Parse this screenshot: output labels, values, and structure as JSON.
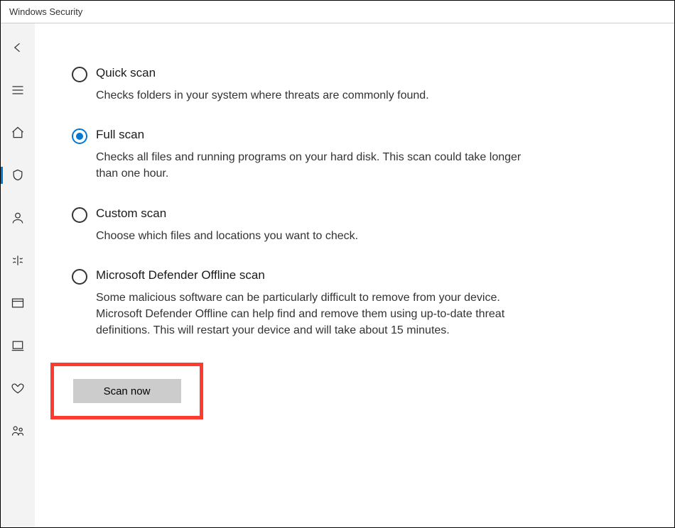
{
  "window": {
    "title": "Windows Security"
  },
  "sidebar": {
    "items": [
      {
        "name": "back-icon"
      },
      {
        "name": "menu-icon"
      },
      {
        "name": "home-icon"
      },
      {
        "name": "shield-icon",
        "active": true
      },
      {
        "name": "account-icon"
      },
      {
        "name": "firewall-icon"
      },
      {
        "name": "app-browser-icon"
      },
      {
        "name": "device-security-icon"
      },
      {
        "name": "health-icon"
      },
      {
        "name": "family-icon"
      }
    ]
  },
  "options": [
    {
      "id": "quick",
      "label": "Quick scan",
      "desc": "Checks folders in your system where threats are commonly found.",
      "selected": false
    },
    {
      "id": "full",
      "label": "Full scan",
      "desc": "Checks all files and running programs on your hard disk. This scan could take longer than one hour.",
      "selected": true
    },
    {
      "id": "custom",
      "label": "Custom scan",
      "desc": "Choose which files and locations you want to check.",
      "selected": false
    },
    {
      "id": "offline",
      "label": "Microsoft Defender Offline scan",
      "desc": "Some malicious software can be particularly difficult to remove from your device. Microsoft Defender Offline can help find and remove them using up-to-date threat definitions. This will restart your device and will take about 15 minutes.",
      "selected": false
    }
  ],
  "scan_button": "Scan now"
}
